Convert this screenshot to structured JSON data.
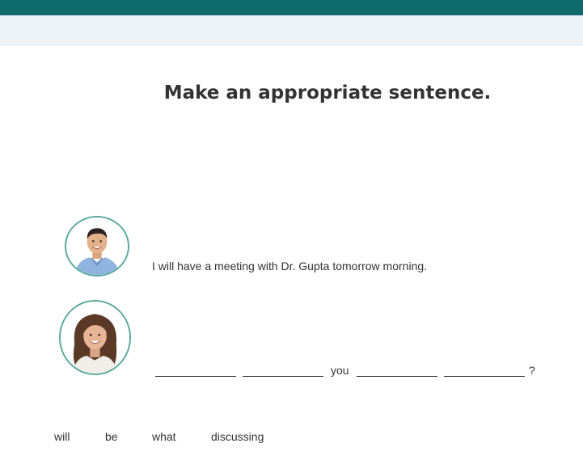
{
  "instruction": {
    "title": "Make an appropriate sentence."
  },
  "dialogue": {
    "line_1": {
      "text": "I will have a meeting with Dr. Gupta tomorrow morning."
    },
    "line_2": {
      "fixed_word": "you",
      "end_punctuation": "?",
      "blank_count": 4
    }
  },
  "word_bank": [
    "will",
    "be",
    "what",
    "discussing"
  ],
  "colors": {
    "header": "#0f6b6b",
    "subheader": "#eef2f9",
    "avatar_ring": "#5aa99b"
  },
  "icons": {
    "speaker_1": "man-avatar-icon",
    "speaker_2": "woman-avatar-icon"
  }
}
